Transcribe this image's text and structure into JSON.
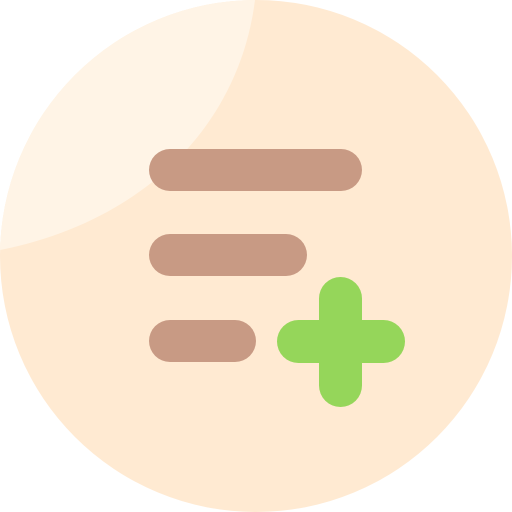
{
  "icon": {
    "name": "add-to-list-icon",
    "colors": {
      "background": "#ffffff",
      "circle": "#FFEAD2",
      "highlight": "#FFF4E6",
      "lines": "#C89A84",
      "plus": "#95D65A"
    }
  }
}
